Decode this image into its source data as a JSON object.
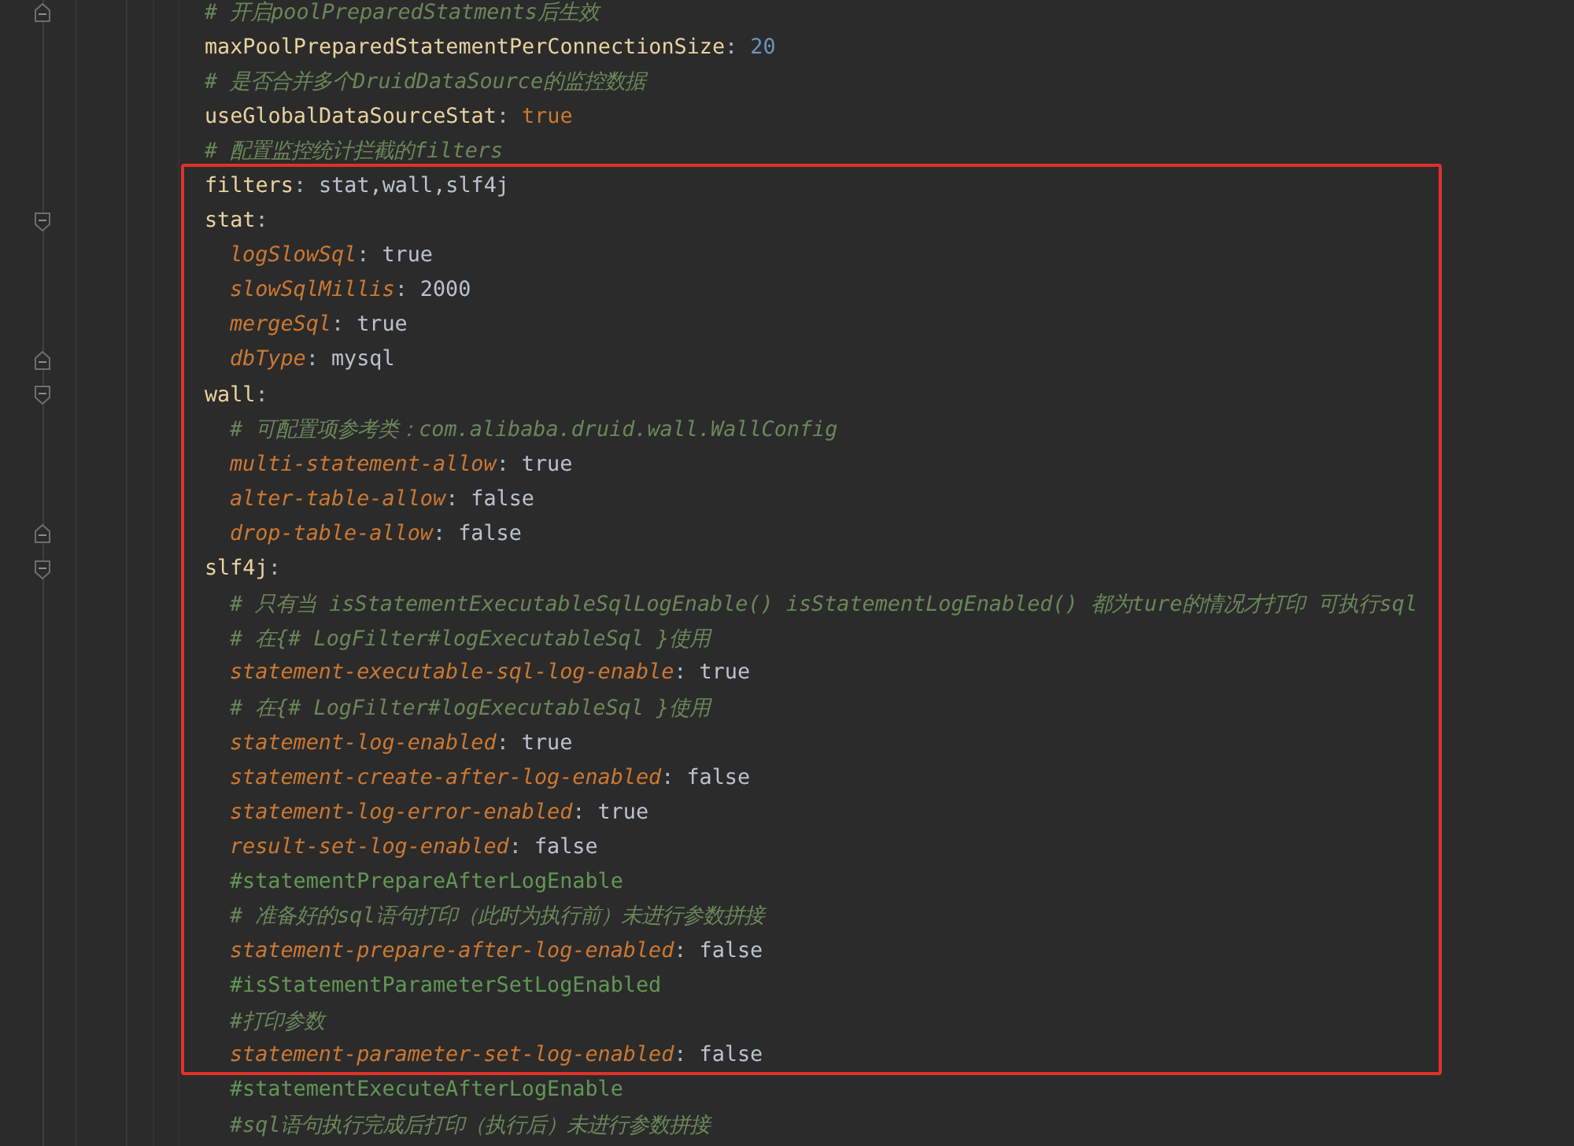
{
  "before": [
    {
      "kind": "comment",
      "text": "# 开启poolPreparedStatments后生效",
      "fold_end": true
    },
    {
      "kind": "number_setting",
      "key": "maxPoolPreparedStatementPerConnectionSize:",
      "value": "20",
      "fold_end": false
    },
    {
      "kind": "comment",
      "text": "# 是否合并多个DruidDataSource的监控数据",
      "fold_end": false
    },
    {
      "kind": "flag_setting",
      "key": "useGlobalDataSourceStat:",
      "value": "true",
      "fold_end": false
    },
    {
      "kind": "comment",
      "text": "# 配置监控统计拦截的filters",
      "fold_end": false
    }
  ],
  "highlighted": [
    {
      "kind": "setting",
      "key": "filters:",
      "value": "stat,wall,slf4j",
      "fold_end": false
    },
    {
      "kind": "section",
      "key": "stat:",
      "fold_end": false,
      "children": [
        {
          "kind": "setting",
          "key": "logSlowSql:",
          "value": "true",
          "fold_end": false
        },
        {
          "kind": "setting",
          "key": "slowSqlMillis:",
          "value": "2000",
          "fold_end": false
        },
        {
          "kind": "setting",
          "key": "mergeSql:",
          "value": "true",
          "fold_end": false
        },
        {
          "kind": "setting",
          "key": "dbType:",
          "value": "mysql",
          "fold_end": true
        }
      ]
    },
    {
      "kind": "section",
      "key": "wall:",
      "fold_end": false,
      "children": [
        {
          "kind": "comment",
          "text": "# 可配置项参考类：com.alibaba.druid.wall.WallConfig",
          "fold_end": false
        },
        {
          "kind": "setting",
          "key": "multi-statement-allow:",
          "value": "true",
          "fold_end": false
        },
        {
          "kind": "setting",
          "key": "alter-table-allow:",
          "value": "false",
          "fold_end": false
        },
        {
          "kind": "setting",
          "key": "drop-table-allow:",
          "value": "false",
          "fold_end": true
        }
      ]
    },
    {
      "kind": "section",
      "key": "slf4j:",
      "fold_end": false,
      "children": [
        {
          "kind": "comment",
          "text": "# 只有当 isStatementExecutableSqlLogEnable() isStatementLogEnabled() 都为ture的情况才打印 可执行sql",
          "fold_end": false
        },
        {
          "kind": "comment",
          "text": "# 在{# LogFilter#logExecutableSql }使用",
          "fold_end": false
        },
        {
          "kind": "setting",
          "key": "statement-executable-sql-log-enable:",
          "value": "true",
          "fold_end": false
        },
        {
          "kind": "comment",
          "text": "# 在{# LogFilter#logExecutableSql }使用",
          "fold_end": false
        },
        {
          "kind": "setting",
          "key": "statement-log-enabled:",
          "value": "true",
          "fold_end": false
        },
        {
          "kind": "setting",
          "key": "statement-create-after-log-enabled:",
          "value": "false",
          "fold_end": false
        },
        {
          "kind": "setting",
          "key": "statement-log-error-enabled:",
          "value": "true",
          "fold_end": false
        },
        {
          "kind": "setting",
          "key": "result-set-log-enabled:",
          "value": "false",
          "fold_end": false
        },
        {
          "kind": "disabled_line",
          "text": "#statementPrepareAfterLogEnable",
          "fold_end": false
        },
        {
          "kind": "comment",
          "text": "# 准备好的sql语句打印（此时为执行前）未进行参数拼接",
          "fold_end": false
        },
        {
          "kind": "setting",
          "key": "statement-prepare-after-log-enabled:",
          "value": "false",
          "fold_end": false
        },
        {
          "kind": "disabled_line",
          "text": "#isStatementParameterSetLogEnabled",
          "fold_end": false
        },
        {
          "kind": "comment",
          "text": "#打印参数",
          "fold_end": false
        },
        {
          "kind": "setting",
          "key": "statement-parameter-set-log-enabled:",
          "value": "false",
          "fold_end": false
        }
      ]
    }
  ],
  "after": {
    "children": [
      {
        "kind": "disabled_line",
        "text": "#statementExecuteAfterLogEnable",
        "fold_end": false
      },
      {
        "kind": "comment",
        "text": "#sql语句执行完成后打印（执行后）未进行参数拼接",
        "fold_end": false
      }
    ]
  }
}
